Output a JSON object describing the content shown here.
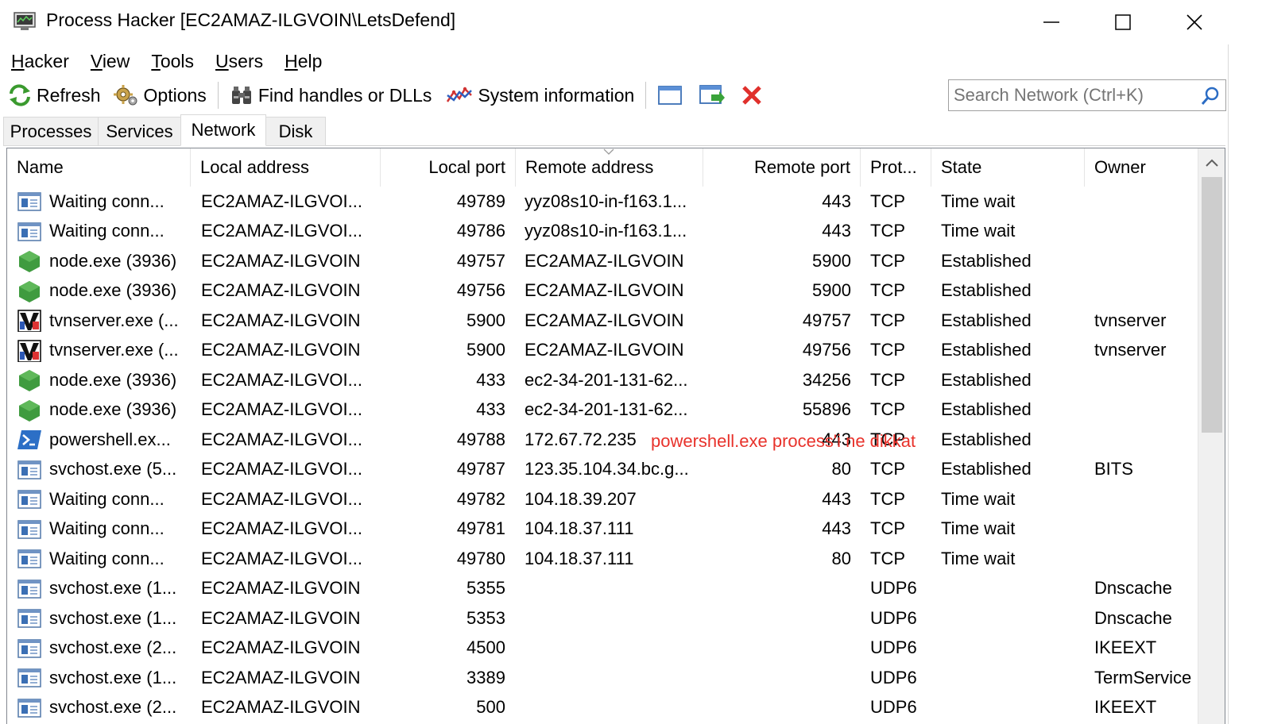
{
  "window": {
    "title": "Process Hacker [EC2AMAZ-ILGVOIN\\LetsDefend]"
  },
  "menu": [
    {
      "u": "H",
      "rest": "acker"
    },
    {
      "u": "V",
      "rest": "iew"
    },
    {
      "u": "T",
      "rest": "ools"
    },
    {
      "u": "U",
      "rest": "sers"
    },
    {
      "u": "H",
      "rest": "elp"
    }
  ],
  "toolbar": {
    "refresh": "Refresh",
    "options": "Options",
    "find_handles": "Find handles or DLLs",
    "system_information": "System information",
    "search_placeholder": "Search Network (Ctrl+K)"
  },
  "tabs": [
    "Processes",
    "Services",
    "Network",
    "Disk"
  ],
  "active_tab": "Network",
  "columns": [
    "Name",
    "Local address",
    "Local port",
    "Remote address",
    "Remote port",
    "Prot...",
    "State",
    "Owner"
  ],
  "rows": [
    {
      "icon": "window-icon",
      "name": "Waiting conn...",
      "local_address": "EC2AMAZ-ILGVOI...",
      "local_port": "49789",
      "remote_address": "yyz08s10-in-f163.1...",
      "remote_port": "443",
      "protocol": "TCP",
      "state": "Time wait",
      "owner": ""
    },
    {
      "icon": "window-icon",
      "name": "Waiting conn...",
      "local_address": "EC2AMAZ-ILGVOI...",
      "local_port": "49786",
      "remote_address": "yyz08s10-in-f163.1...",
      "remote_port": "443",
      "protocol": "TCP",
      "state": "Time wait",
      "owner": ""
    },
    {
      "icon": "node-icon",
      "name": "node.exe (3936)",
      "local_address": "EC2AMAZ-ILGVOIN",
      "local_port": "49757",
      "remote_address": "EC2AMAZ-ILGVOIN",
      "remote_port": "5900",
      "protocol": "TCP",
      "state": "Established",
      "owner": ""
    },
    {
      "icon": "node-icon",
      "name": "node.exe (3936)",
      "local_address": "EC2AMAZ-ILGVOIN",
      "local_port": "49756",
      "remote_address": "EC2AMAZ-ILGVOIN",
      "remote_port": "5900",
      "protocol": "TCP",
      "state": "Established",
      "owner": ""
    },
    {
      "icon": "tightvnc-icon",
      "name": "tvnserver.exe (...",
      "local_address": "EC2AMAZ-ILGVOIN",
      "local_port": "5900",
      "remote_address": "EC2AMAZ-ILGVOIN",
      "remote_port": "49757",
      "protocol": "TCP",
      "state": "Established",
      "owner": "tvnserver"
    },
    {
      "icon": "tightvnc-icon",
      "name": "tvnserver.exe (...",
      "local_address": "EC2AMAZ-ILGVOIN",
      "local_port": "5900",
      "remote_address": "EC2AMAZ-ILGVOIN",
      "remote_port": "49756",
      "protocol": "TCP",
      "state": "Established",
      "owner": "tvnserver"
    },
    {
      "icon": "node-icon",
      "name": "node.exe (3936)",
      "local_address": "EC2AMAZ-ILGVOI...",
      "local_port": "433",
      "remote_address": "ec2-34-201-131-62...",
      "remote_port": "34256",
      "protocol": "TCP",
      "state": "Established",
      "owner": ""
    },
    {
      "icon": "node-icon",
      "name": "node.exe (3936)",
      "local_address": "EC2AMAZ-ILGVOI...",
      "local_port": "433",
      "remote_address": "ec2-34-201-131-62...",
      "remote_port": "55896",
      "protocol": "TCP",
      "state": "Established",
      "owner": ""
    },
    {
      "icon": "powershell-icon",
      "name": "powershell.ex...",
      "local_address": "EC2AMAZ-ILGVOI...",
      "local_port": "49788",
      "remote_address": "172.67.72.235",
      "remote_port": "443",
      "protocol": "TCP",
      "state": "Established",
      "owner": ""
    },
    {
      "icon": "window-icon",
      "name": "svchost.exe (5...",
      "local_address": "EC2AMAZ-ILGVOI...",
      "local_port": "49787",
      "remote_address": "123.35.104.34.bc.g...",
      "remote_port": "80",
      "protocol": "TCP",
      "state": "Established",
      "owner": "BITS"
    },
    {
      "icon": "window-icon",
      "name": "Waiting conn...",
      "local_address": "EC2AMAZ-ILGVOI...",
      "local_port": "49782",
      "remote_address": "104.18.39.207",
      "remote_port": "443",
      "protocol": "TCP",
      "state": "Time wait",
      "owner": ""
    },
    {
      "icon": "window-icon",
      "name": "Waiting conn...",
      "local_address": "EC2AMAZ-ILGVOI...",
      "local_port": "49781",
      "remote_address": "104.18.37.111",
      "remote_port": "443",
      "protocol": "TCP",
      "state": "Time wait",
      "owner": ""
    },
    {
      "icon": "window-icon",
      "name": "Waiting conn...",
      "local_address": "EC2AMAZ-ILGVOI...",
      "local_port": "49780",
      "remote_address": "104.18.37.111",
      "remote_port": "80",
      "protocol": "TCP",
      "state": "Time wait",
      "owner": ""
    },
    {
      "icon": "window-icon",
      "name": "svchost.exe (1...",
      "local_address": "EC2AMAZ-ILGVOIN",
      "local_port": "5355",
      "remote_address": "",
      "remote_port": "",
      "protocol": "UDP6",
      "state": "",
      "owner": "Dnscache"
    },
    {
      "icon": "window-icon",
      "name": "svchost.exe (1...",
      "local_address": "EC2AMAZ-ILGVOIN",
      "local_port": "5353",
      "remote_address": "",
      "remote_port": "",
      "protocol": "UDP6",
      "state": "",
      "owner": "Dnscache"
    },
    {
      "icon": "window-icon",
      "name": "svchost.exe (2...",
      "local_address": "EC2AMAZ-ILGVOIN",
      "local_port": "4500",
      "remote_address": "",
      "remote_port": "",
      "protocol": "UDP6",
      "state": "",
      "owner": "IKEEXT"
    },
    {
      "icon": "window-icon",
      "name": "svchost.exe (1...",
      "local_address": "EC2AMAZ-ILGVOIN",
      "local_port": "3389",
      "remote_address": "",
      "remote_port": "",
      "protocol": "UDP6",
      "state": "",
      "owner": "TermService"
    },
    {
      "icon": "window-icon",
      "name": "svchost.exe (2...",
      "local_address": "EC2AMAZ-ILGVOIN",
      "local_port": "500",
      "remote_address": "",
      "remote_port": "",
      "protocol": "UDP6",
      "state": "",
      "owner": "IKEEXT"
    }
  ],
  "annotation": "powershell.exe process'i ne dikkat",
  "colors": {
    "annotation": "#e8322b",
    "node_green": "#3f9b3f",
    "powershell_blue": "#2c6fc6",
    "close_red": "#e0302c"
  }
}
